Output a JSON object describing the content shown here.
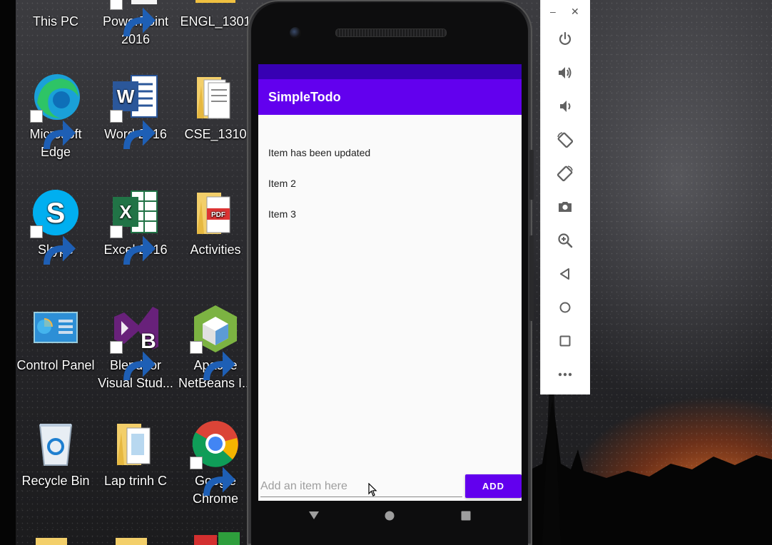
{
  "desktop": {
    "icons": [
      {
        "label": "This PC",
        "icon": "this-pc-icon"
      },
      {
        "label": "PowerPoint 2016",
        "icon": "powerpoint-icon"
      },
      {
        "label": "ENGL_1301",
        "icon": "folder-icon"
      },
      {
        "label": "Microsoft Edge",
        "icon": "edge-icon"
      },
      {
        "label": "Word 2016",
        "icon": "word-icon"
      },
      {
        "label": "CSE_1310",
        "icon": "folder-icon"
      },
      {
        "label": "Skype",
        "icon": "skype-icon"
      },
      {
        "label": "Excel 2016",
        "icon": "excel-icon"
      },
      {
        "label": "Activities",
        "icon": "folder-pdf-icon"
      },
      {
        "label": "Control Panel",
        "icon": "control-panel-icon"
      },
      {
        "label": "Blend for Visual Stud...",
        "icon": "blend-icon"
      },
      {
        "label": "Apache NetBeans I...",
        "icon": "netbeans-icon"
      },
      {
        "label": "Recycle Bin",
        "icon": "recycle-bin-icon"
      },
      {
        "label": "Lap trinh C",
        "icon": "folder-icon"
      },
      {
        "label": "Google Chrome",
        "icon": "chrome-icon"
      }
    ]
  },
  "app": {
    "title": "SimpleTodo",
    "items": [
      "Item has been updated",
      "Item 2",
      "Item 3"
    ],
    "input_placeholder": "Add an item here",
    "add_label": "ADD",
    "colors": {
      "primary": "#6200ee",
      "primary_dark": "#3700b3"
    }
  },
  "phone_nav": [
    "back-icon",
    "home-icon",
    "recents-icon"
  ],
  "emulator_toolbar": {
    "window_controls": {
      "minimize": "–",
      "close": "✕"
    },
    "buttons": [
      "power-icon",
      "volume-up-icon",
      "volume-down-icon",
      "rotate-left-icon",
      "rotate-right-icon",
      "camera-icon",
      "zoom-icon",
      "back-icon",
      "home-icon",
      "overview-icon",
      "more-icon"
    ]
  }
}
